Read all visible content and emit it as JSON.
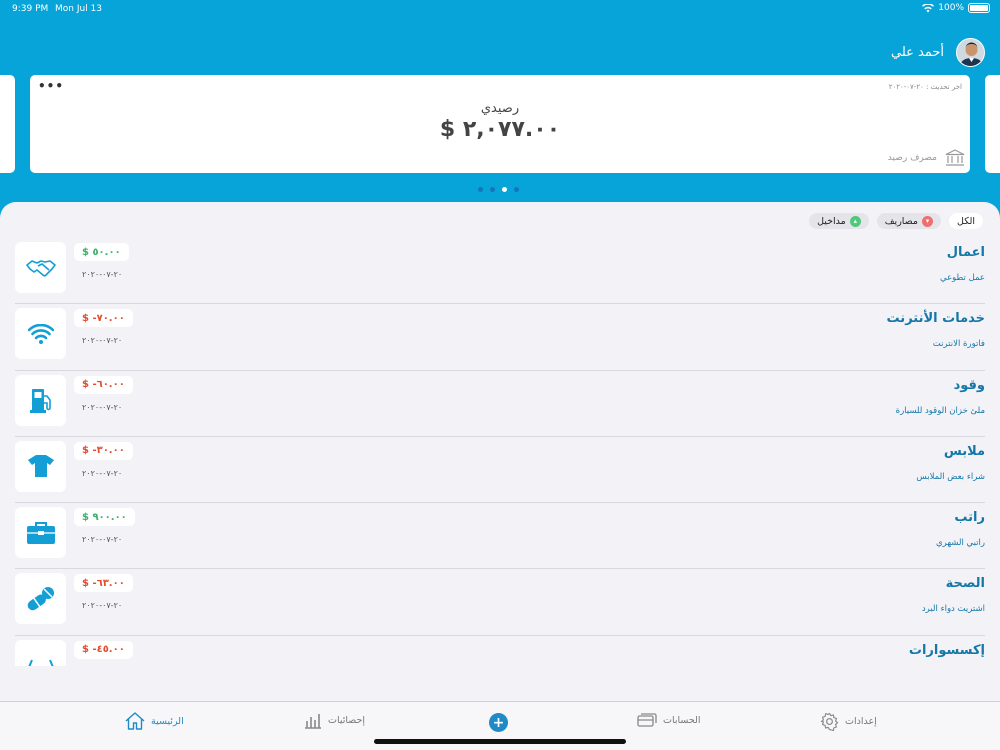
{
  "status": {
    "time": "9:39 PM",
    "date": "Mon Jul 13",
    "battery": "100%",
    "battery_level": 1.0
  },
  "user": {
    "name": "أحمد علي"
  },
  "card": {
    "menu": "•••",
    "updated": "اخر تحديث : ٢٠-٠٧-٢٠٢٠",
    "balance_label": "رصيدي",
    "balance": "$ ٢,٠٧٧.٠٠",
    "bank_label": "مصرف رصيد"
  },
  "pager": {
    "count": 4,
    "active_index": 2
  },
  "filters": [
    {
      "label": "الكل",
      "active": true
    },
    {
      "label": "مصاريف",
      "type": "expense",
      "color": "#ef6f6f"
    },
    {
      "label": "مداخيل",
      "type": "income",
      "color": "#4cc97a"
    }
  ],
  "transactions": [
    {
      "title": "اعمال",
      "subtitle": "عمل تطوعي",
      "amount": "$ ٥٠.٠٠",
      "positive": true,
      "date": "٢٠-٠٧-٢٠٢٠",
      "icon": "handshake-icon"
    },
    {
      "title": "خدمات الأنترنت",
      "subtitle": "فاتورة الانترنت",
      "amount": "$ -٧٠.٠٠",
      "positive": false,
      "date": "٢٠-٠٧-٢٠٢٠",
      "icon": "wifi-icon"
    },
    {
      "title": "وقود",
      "subtitle": "ملئ خزان الوقود للسيارة",
      "amount": "$ -٦٠.٠٠",
      "positive": false,
      "date": "٢٠-٠٧-٢٠٢٠",
      "icon": "fuel-pump-icon"
    },
    {
      "title": "ملابس",
      "subtitle": "شراء بعض الملابس",
      "amount": "$ -٣٠.٠٠",
      "positive": false,
      "date": "٢٠-٠٧-٢٠٢٠",
      "icon": "tshirt-icon"
    },
    {
      "title": "راتب",
      "subtitle": "راتبي الشهري",
      "amount": "$ ٩٠٠.٠٠",
      "positive": true,
      "date": "٢٠-٠٧-٢٠٢٠",
      "icon": "briefcase-icon"
    },
    {
      "title": "الصحة",
      "subtitle": "اشتريت دواء البرد",
      "amount": "$ -٦٣.٠٠",
      "positive": false,
      "date": "٢٠-٠٧-٢٠٢٠",
      "icon": "pills-icon"
    },
    {
      "title": "إكسسوارات",
      "subtitle": "",
      "amount": "$ -٤٥.٠٠",
      "positive": false,
      "date": "",
      "icon": "glasses-icon"
    }
  ],
  "tabs": {
    "home": "الرئيسية",
    "stats": "إحصائيات",
    "add": "+",
    "accounts": "الحسابات",
    "settings": "إعدادات"
  },
  "colors": {
    "primary": "#06a4d8",
    "positive": "#38b26a",
    "negative": "#e34c30",
    "accent": "#1f8ac8",
    "title": "#1477a8"
  }
}
